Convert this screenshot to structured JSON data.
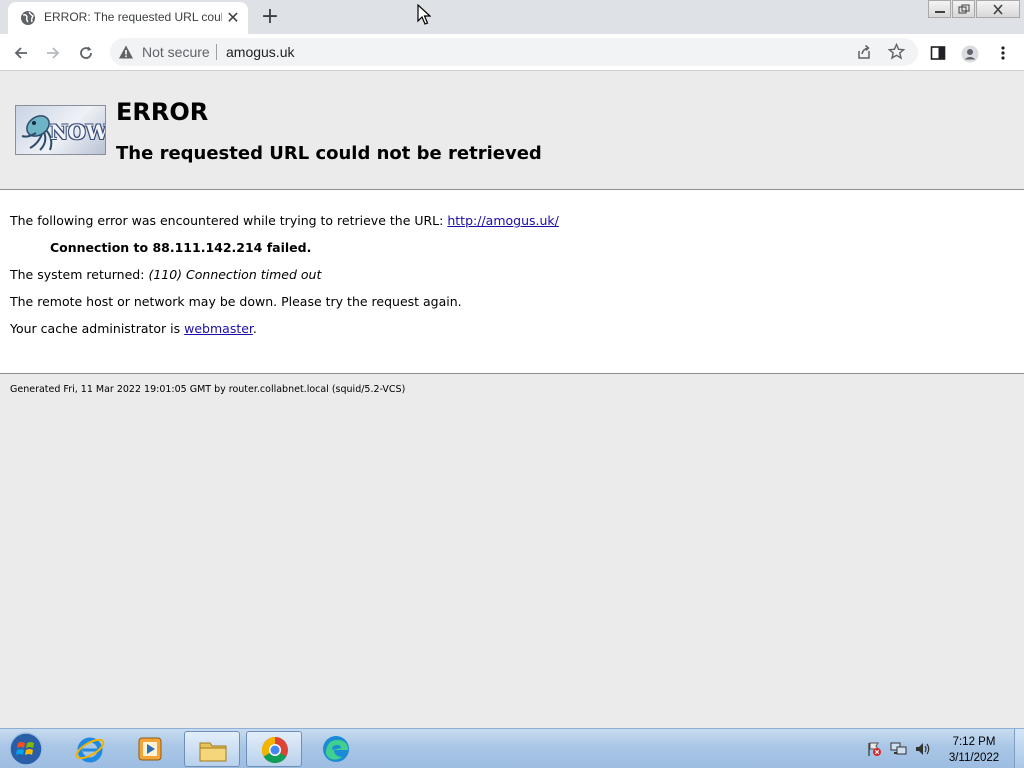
{
  "browser": {
    "tab": {
      "title": "ERROR: The requested URL could not be retrieved"
    },
    "address_bar": {
      "security_label": "Not secure",
      "url": "amogus.uk"
    }
  },
  "page": {
    "heading": "ERROR",
    "subheading": "The requested URL could not be retrieved",
    "intro_text": "The following error was encountered while trying to retrieve the URL:",
    "intro_link": "http://amogus.uk/",
    "error_detail": "Connection to 88.111.142.214 failed.",
    "system_returned_label": "The system returned:",
    "system_returned_value": "(110) Connection timed out",
    "advice": "The remote host or network may be down. Please try the request again.",
    "admin_text": "Your cache administrator is",
    "admin_link": "webmaster",
    "admin_suffix": ".",
    "footer": "Generated Fri, 11 Mar 2022 19:01:05 GMT by router.collabnet.local (squid/5.2-VCS)",
    "logo_text": "NOW"
  },
  "taskbar": {
    "clock_time": "7:12 PM",
    "clock_date": "3/11/2022",
    "apps": [
      "internet-explorer",
      "media-player",
      "file-explorer",
      "chrome",
      "edge"
    ]
  },
  "colors": {
    "link": "#1a0dab",
    "page_background": "#ebebeb",
    "content_background": "#ffffff",
    "tabstrip": "#dee1e6"
  }
}
